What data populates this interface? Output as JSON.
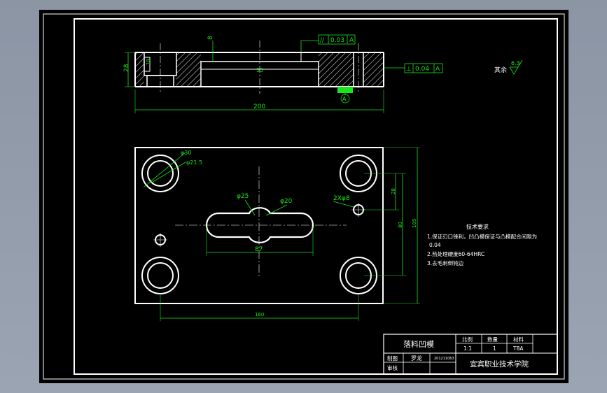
{
  "drawing": {
    "dims": {
      "d8_top": "8",
      "d28_height": "28",
      "d18": "18",
      "d35": "35",
      "d200": "200",
      "phi30": "φ30",
      "phi21_5": "φ21.5",
      "phi25": "φ25",
      "phi20": "φ20",
      "holes_2x8": "2Xφ8",
      "d28_right": "28",
      "d80": "80",
      "d105": "105",
      "d87": "87",
      "d160": "160"
    },
    "tolerances": {
      "parallel_symbol": "//",
      "parallel_value": "0.03",
      "parallel_datum": "A",
      "perp_symbol": "⊥",
      "perp_value": "0.04",
      "perp_datum": "A",
      "datum_label": "A"
    },
    "roughness": {
      "prefix": "其余",
      "value": "6.3"
    },
    "notes": {
      "title": "技术要求",
      "lines": [
        "1.保证刃口锋利，凹凸模保证与凸模配合间隙为",
        "0.04",
        "2.热处理硬度60-64HRC",
        "3.去毛刺倒钝边"
      ]
    },
    "title_block": {
      "part_name": "落料凹模",
      "scale_label": "比例",
      "qty_label": "数量",
      "material_label": "材料",
      "scale_value": "1:1",
      "qty_value": "1",
      "material_value": "T8A",
      "drawn_label": "制图",
      "drawn_name": "罗龙",
      "drawn_id": "201211063",
      "check_label": "审核",
      "school": "宜宾职业技术学院"
    }
  },
  "colors": {
    "background": "#8e99a8",
    "sheet": "#000000",
    "lines": "#ffffff",
    "dims": "#19e619"
  }
}
